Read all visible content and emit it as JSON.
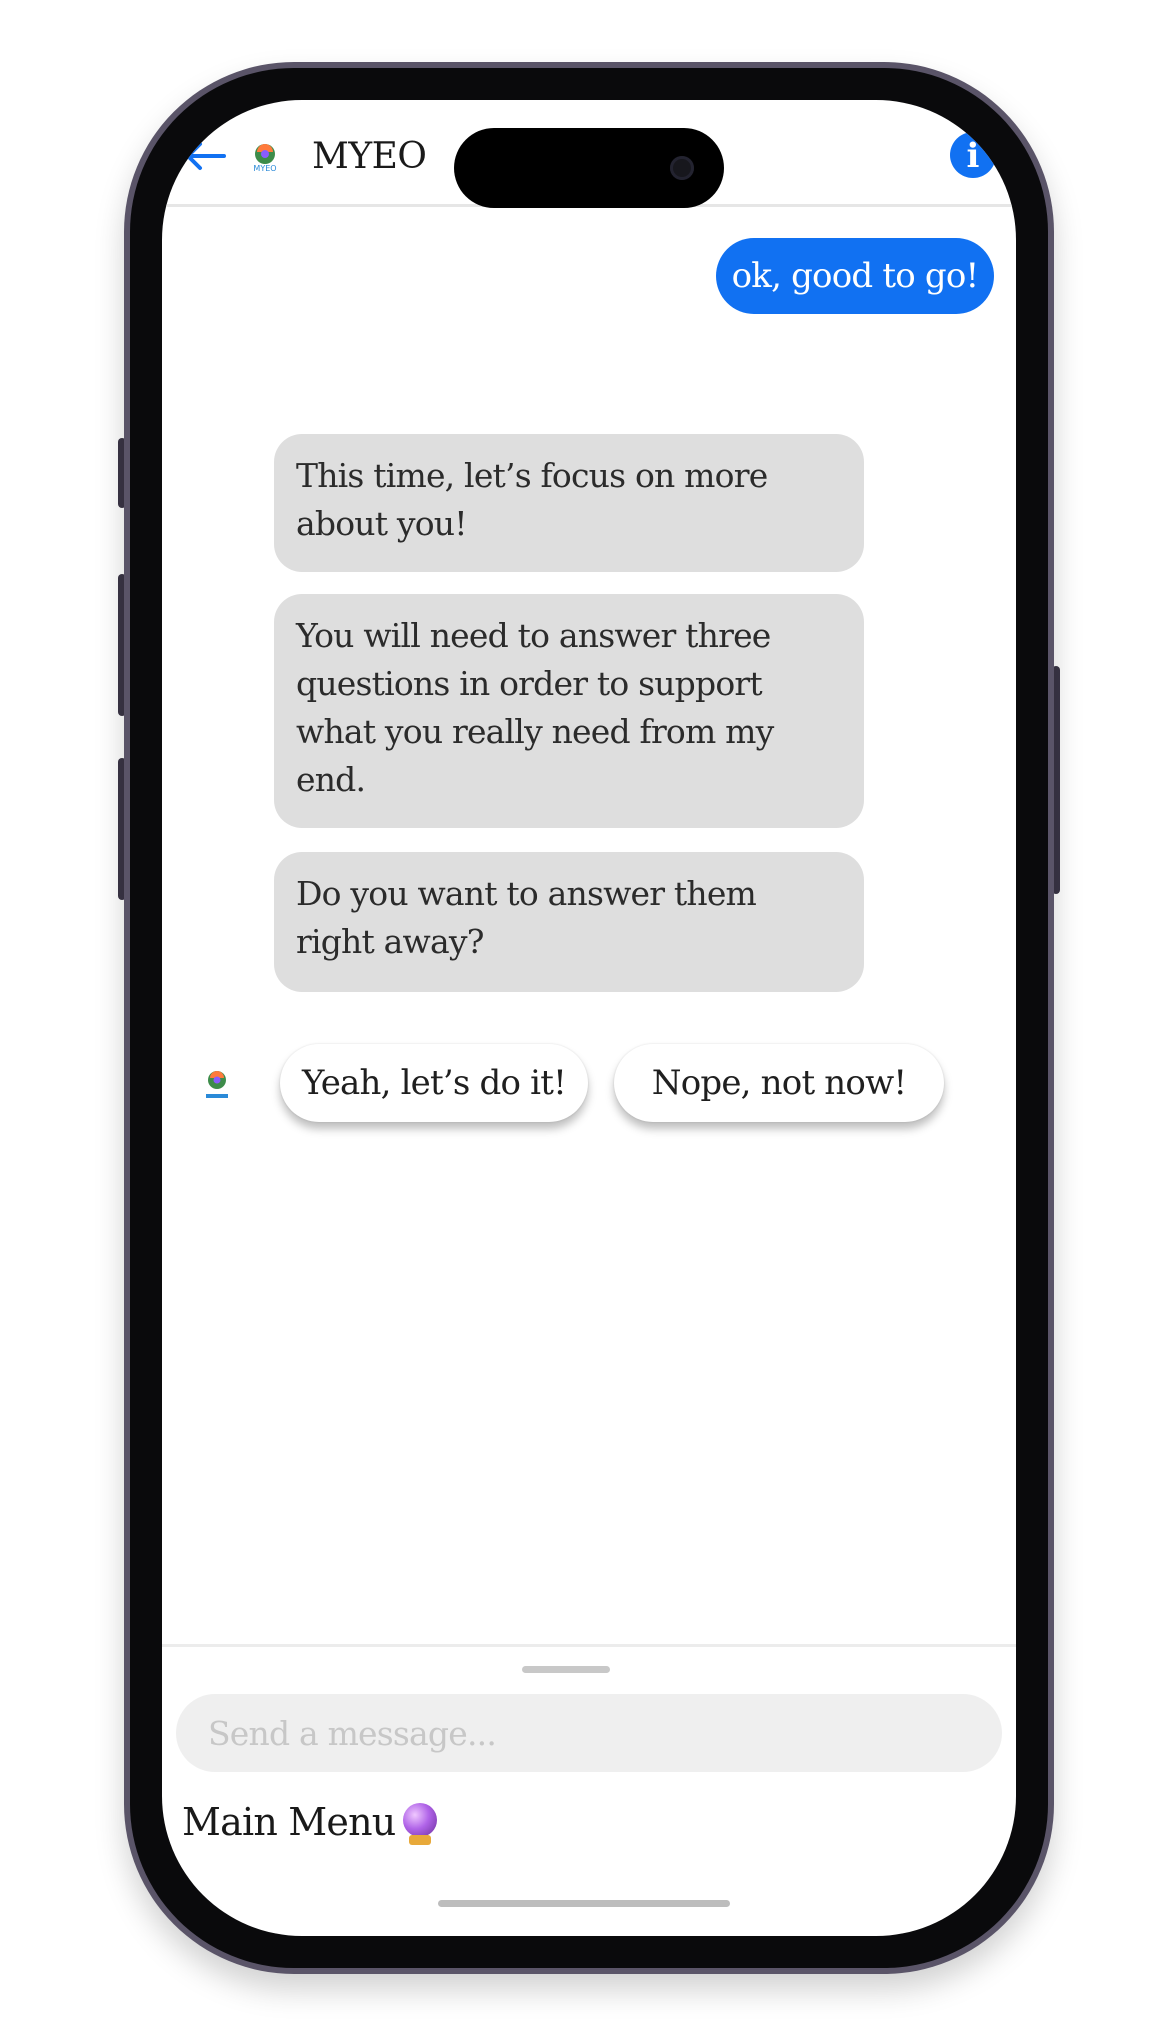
{
  "header": {
    "title": "MYEO",
    "logo_text": "MYEO",
    "back_icon": "arrow-left-icon",
    "info_icon": "info-icon"
  },
  "messages": [
    {
      "from": "user",
      "text": "ok, good to go!"
    },
    {
      "from": "bot",
      "text": "This time, let’s focus on more about you!"
    },
    {
      "from": "bot",
      "text": "You will need to answer three questions in order to support what you really need from my end."
    },
    {
      "from": "bot",
      "text": "Do you want to answer them right away?"
    }
  ],
  "quick_replies": [
    "Yeah, let’s do it!",
    "Nope, not now!"
  ],
  "composer": {
    "placeholder": "Send a message..."
  },
  "footer": {
    "main_menu_label": "Main Menu",
    "main_menu_icon": "crystal-ball-icon"
  },
  "colors": {
    "accent": "#1171f2",
    "bot_bubble": "#dedede",
    "input_bg": "#efefef"
  }
}
